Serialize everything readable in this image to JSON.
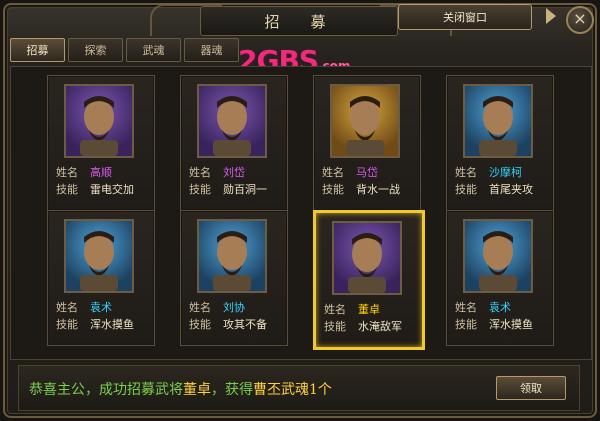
{
  "title": "招　募",
  "close_window_label": "关闭窗口",
  "tabs": [
    "招募",
    "探索",
    "武魂",
    "器魂"
  ],
  "watermark": {
    "text": "2GBS",
    "suffix": ".com"
  },
  "labels": {
    "name": "姓名",
    "skill": "技能"
  },
  "cards": [
    {
      "name": "高顺",
      "skill": "雷电交加",
      "rarity": "purple"
    },
    {
      "name": "刘岱",
      "skill": "勋百洞一",
      "rarity": "purple"
    },
    {
      "name": "马岱",
      "skill": "背水一战",
      "rarity": "gold"
    },
    {
      "name": "沙摩柯",
      "skill": "首尾夹攻",
      "rarity": "blue"
    },
    {
      "name": "袁术",
      "skill": "浑水摸鱼",
      "rarity": "blue"
    },
    {
      "name": "刘协",
      "skill": "攻其不备",
      "rarity": "blue"
    },
    {
      "name": "董卓",
      "skill": "水淹敌军",
      "rarity": "purple",
      "selected": true
    },
    {
      "name": "袁术",
      "skill": "浑水摸鱼",
      "rarity": "blue"
    }
  ],
  "message": {
    "prefix": "恭喜主公，成功招募武将",
    "general": "董卓",
    "middle": "，获得",
    "soul": "曹丕武魂1个"
  },
  "claim_label": "领取",
  "colors": {
    "selected_border": "#f0c92d",
    "purple": "#d95df2",
    "blue": "#34d3ff",
    "yellow": "#ffd400",
    "green": "#7bd04d"
  }
}
